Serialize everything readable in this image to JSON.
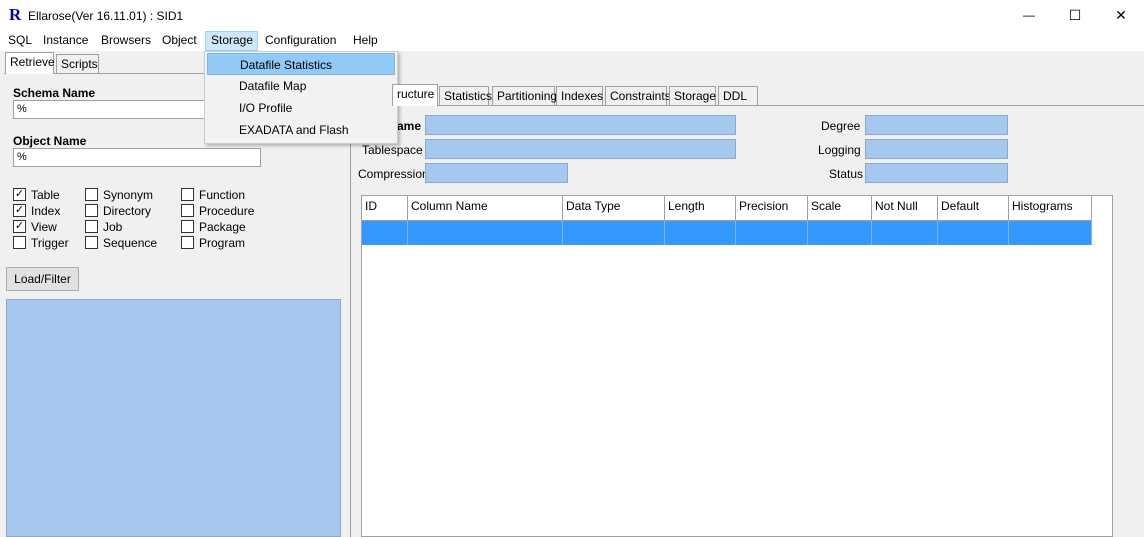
{
  "window": {
    "icon_letter": "R",
    "title": "Ellarose(Ver 16.11.01) : SID1",
    "minimize_glyph": "—",
    "maximize_glyph": "☐",
    "close_glyph": "✕"
  },
  "menu": {
    "sql": "SQL",
    "instance": "Instance",
    "browsers": "Browsers",
    "object": "Object",
    "storage": "Storage",
    "configuration": "Configuration",
    "help": "Help"
  },
  "storage_menu": {
    "items": [
      "Datafile Statistics",
      "Datafile Map",
      "I/O Profile",
      "EXADATA and Flash"
    ],
    "selected": "Datafile Statistics"
  },
  "left_tabs": [
    "Retrieve",
    "Scripts"
  ],
  "left_panel": {
    "schema_label": "Schema Name",
    "schema_value": "%",
    "object_label": "Object Name",
    "object_value": "%",
    "checkboxes": [
      {
        "label": "Table",
        "checked": true
      },
      {
        "label": "Index",
        "checked": true
      },
      {
        "label": "View",
        "checked": true
      },
      {
        "label": "Trigger",
        "checked": false
      },
      {
        "label": "Synonym",
        "checked": false
      },
      {
        "label": "Directory",
        "checked": false
      },
      {
        "label": "Job",
        "checked": false
      },
      {
        "label": "Sequence",
        "checked": false
      },
      {
        "label": "Function",
        "checked": false
      },
      {
        "label": "Procedure",
        "checked": false
      },
      {
        "label": "Package",
        "checked": false
      },
      {
        "label": "Program",
        "checked": false
      }
    ],
    "check_glyph": "✓",
    "load_button": "Load/Filter"
  },
  "right_tabs": [
    "ructure",
    "Statistics",
    "Partitioning",
    "Indexes",
    "Constraints",
    "Storage",
    "DDL"
  ],
  "right_panel": {
    "name_label_partial": "ame",
    "tablespace_label": "Tablespace",
    "compression_label": "Compression",
    "degree_label": "Degree",
    "logging_label": "Logging",
    "status_label": "Status"
  },
  "grid": {
    "columns": [
      "ID",
      "Column Name",
      "Data Type",
      "Length",
      "Precision",
      "Scale",
      "Not Null",
      "Default",
      "Histograms"
    ]
  },
  "colors": {
    "field_blue": "#a6c8ee",
    "row_selected": "#3399ff",
    "menu_highlight": "#91c9f7"
  }
}
